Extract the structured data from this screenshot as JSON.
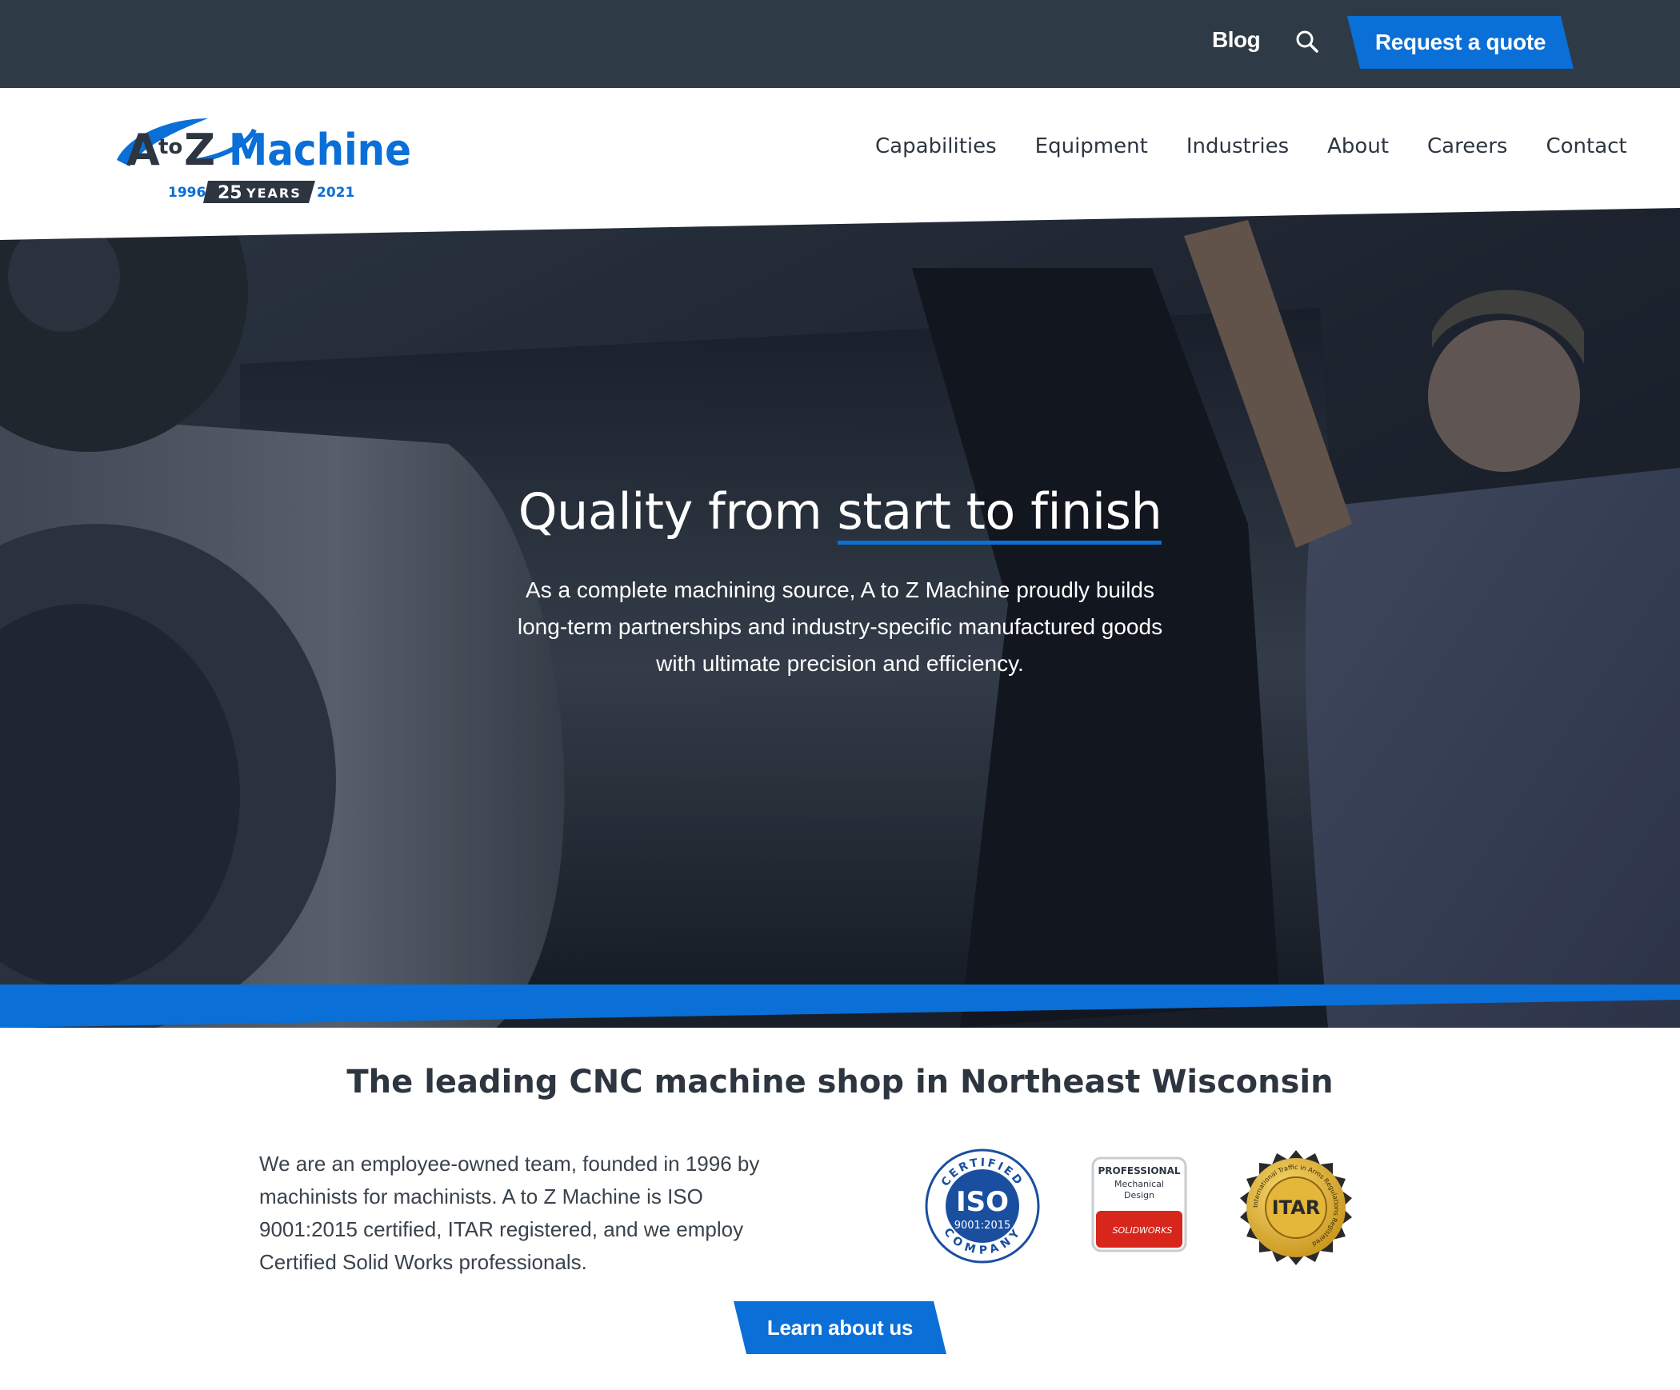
{
  "utility": {
    "blog_label": "Blog",
    "quote_label": "Request a quote"
  },
  "logo": {
    "brand_a": "A",
    "brand_to": "to",
    "brand_z": "Z",
    "brand_machine": "Machine",
    "year_start": "1996",
    "anniversary_num": "25",
    "anniversary_word": "YEARS",
    "year_end": "2021"
  },
  "nav": {
    "items": [
      "Capabilities",
      "Equipment",
      "Industries",
      "About",
      "Careers",
      "Contact"
    ]
  },
  "hero": {
    "title_lead": "Quality from ",
    "title_accent": "start to finish",
    "subtitle": "As a complete machining source, A to Z Machine proudly builds long-term partnerships and industry-specific manufactured goods with ultimate precision and efficiency."
  },
  "section": {
    "title": "The leading CNC machine shop in Northeast Wisconsin",
    "body": "We are an employee-owned team, founded in 1996 by machinists for machinists. A to Z Machine is ISO 9001:2015 certified, ITAR registered, and we employ Certified Solid Works professionals.",
    "cta_label": "Learn about us"
  },
  "badges": {
    "iso_top": "CERTIFIED",
    "iso_main": "ISO",
    "iso_num": "9001:2015",
    "iso_bottom": "COMPANY",
    "sw_line1": "PROFESSIONAL",
    "sw_line2": "Mechanical",
    "sw_line3": "Design",
    "sw_brand": "SOLIDWORKS",
    "itar_main": "ITAR",
    "itar_ring": "International Traffic in Arms Regulations Registered"
  },
  "colors": {
    "dark_bar": "#2e3a46",
    "brand_blue": "#0a6fd6",
    "text_dark": "#2d3640"
  },
  "icons": {
    "search": "search-icon"
  }
}
